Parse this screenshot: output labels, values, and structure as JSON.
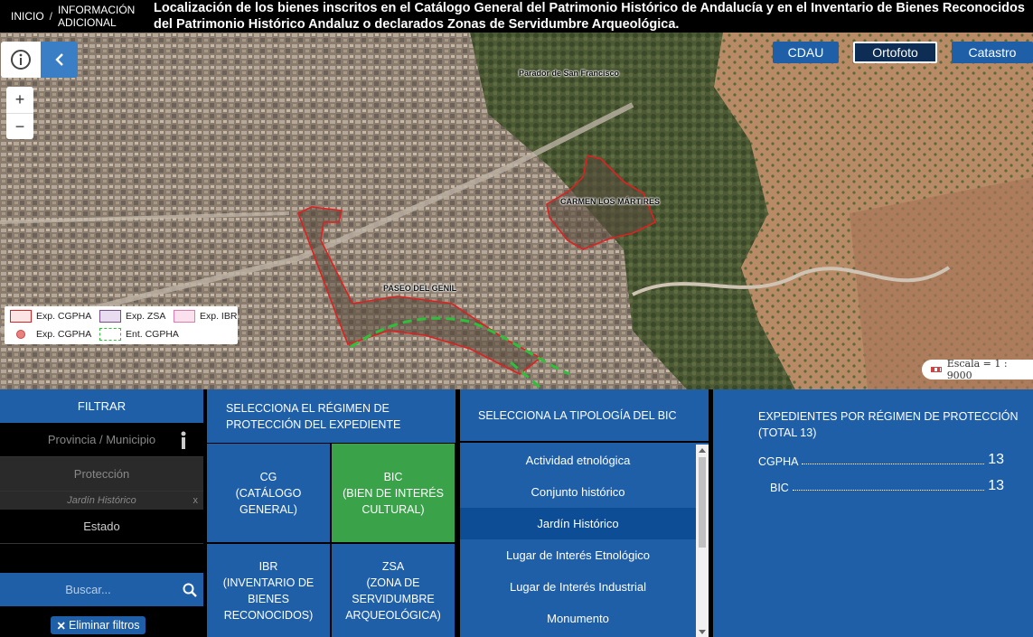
{
  "header": {
    "breadcrumb_home": "INICIO",
    "breadcrumb_sep": "/",
    "breadcrumb_info": "INFORMACIÓN ADICIONAL",
    "title": "Localización de los bienes inscritos en el Catálogo General del Patrimonio Histórico de Andalucía y en el Inventario de Bienes Reconocidos del Patrimonio Histórico Andaluz o declarados Zonas de Servidumbre Arqueológica."
  },
  "map": {
    "layer_buttons": {
      "cdau": "CDAU",
      "ortofoto": "Ortofoto",
      "catastro": "Catastro"
    },
    "active_layer": "Ortofoto",
    "zoom_in": "+",
    "zoom_out": "−",
    "labels": {
      "parador": "Parador de San Francisco",
      "carmen": "CARMEN LOS MÁRTIRES",
      "paseo": "PASEO DEL GENIL"
    },
    "legend": [
      {
        "label": "Exp. CGPHA",
        "icon": "polygon-red"
      },
      {
        "label": "Exp. ZSA",
        "icon": "polygon-purple"
      },
      {
        "label": "Exp. IBR",
        "icon": "polygon-pink"
      },
      {
        "label": "Exp. CGPHA",
        "icon": "point-red"
      },
      {
        "label": "Ent. CGPHA",
        "icon": "polygon-green-dashed"
      }
    ],
    "scale": "Escala = 1 : 9000",
    "colors": {
      "cgpha": "#e02020",
      "zsa": "#7a4c8a",
      "ibr": "#e07ab0",
      "ent": "#2fbf3a"
    }
  },
  "filter": {
    "title": "FILTRAR",
    "provincia": "Provincia / Municipio",
    "proteccion": "Protección",
    "proteccion_selected": "Jardín Histórico",
    "remove": "x",
    "estado": "Estado",
    "search_placeholder": "Buscar...",
    "clear": "Eliminar filtros"
  },
  "regimen": {
    "title": "SELECCIONA EL RÉGIMEN DE PROTECCIÓN DEL EXPEDIENTE",
    "options": {
      "cg": "CG\n(CATÁLOGO GENERAL)",
      "bic": "BIC\n(BIEN DE INTERÉS CULTURAL)",
      "ibr": "IBR\n(INVENTARIO DE BIENES RECONOCIDOS)",
      "zsa": "ZSA\n(ZONA DE SERVIDUMBRE ARQUEOLÓGICA)"
    },
    "selected": "BIC"
  },
  "tipologia": {
    "title": "SELECCIONA LA TIPOLOGÍA DEL BIC",
    "items": [
      "Actividad etnológica",
      "Conjunto histórico",
      "Jardín Histórico",
      "Lugar de Interés Etnológico",
      "Lugar de Interés Industrial",
      "Monumento"
    ],
    "selected": "Jardín Histórico"
  },
  "stats": {
    "title": "EXPEDIENTES POR RÉGIMEN DE PROTECCIÓN (TOTAL 13)",
    "rows": [
      {
        "label": "CGPHA",
        "value": "13"
      },
      {
        "label": "BIC",
        "value": "13"
      }
    ]
  }
}
